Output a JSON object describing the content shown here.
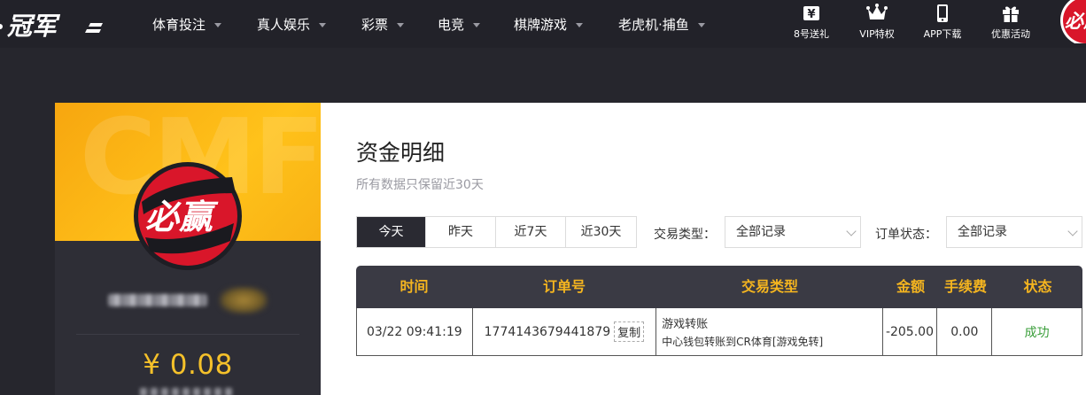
{
  "header": {
    "logo_text": "冠军",
    "nav": [
      {
        "label": "体育投注"
      },
      {
        "label": "真人娱乐"
      },
      {
        "label": "彩票"
      },
      {
        "label": "电竞"
      },
      {
        "label": "棋牌游戏"
      },
      {
        "label": "老虎机·捕鱼"
      }
    ],
    "actions": [
      {
        "label": "8号送礼",
        "icon": "yen-ticket-icon"
      },
      {
        "label": "VIP特权",
        "icon": "crown-icon"
      },
      {
        "label": "APP下载",
        "icon": "phone-icon"
      },
      {
        "label": "优惠活动",
        "icon": "gift-icon"
      }
    ],
    "user_logo_text": "必赢"
  },
  "profile": {
    "banner_watermark": "CMF",
    "avatar_text": "必赢",
    "balance": "¥ 0.08"
  },
  "main": {
    "title": "资金明细",
    "subtitle": "所有数据只保留近30天",
    "ranges": [
      {
        "label": "今天",
        "active": true
      },
      {
        "label": "昨天",
        "active": false
      },
      {
        "label": "近7天",
        "active": false
      },
      {
        "label": "近30天",
        "active": false
      }
    ],
    "filters": {
      "type_label": "交易类型：",
      "type_value": "全部记录",
      "status_label": "订单状态：",
      "status_value": "全部记录"
    },
    "table": {
      "columns": [
        "时间",
        "订单号",
        "交易类型",
        "金额",
        "手续费",
        "状态"
      ],
      "rows": [
        {
          "time": "03/22 09:41:19",
          "order_no": "1774143679441879",
          "copy_label": "复制",
          "type_main": "游戏转账",
          "type_desc": "中心钱包转账到CR体育[游戏免转]",
          "amount": "-205.00",
          "fee": "0.00",
          "status": "成功"
        }
      ]
    }
  },
  "colors": {
    "accent": "#f5b51f",
    "dark": "#26262d",
    "success": "#3a9e3a",
    "avatar_red": "#d9162a"
  }
}
